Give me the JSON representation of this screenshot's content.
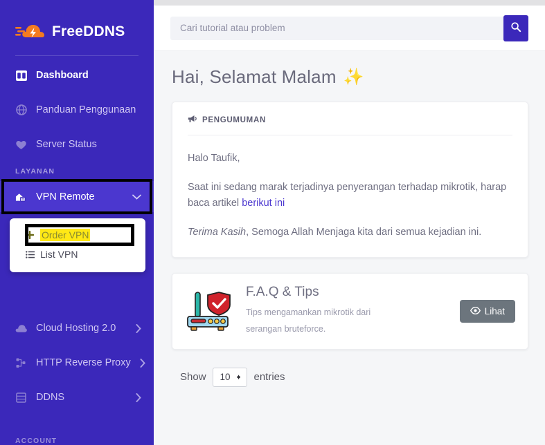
{
  "brand": {
    "name": "FreeDDNS",
    "logo_icon": "cloud-bolt-icon"
  },
  "sidebar": {
    "items_top": [
      {
        "label": "Dashboard",
        "icon": "dashboard-icon",
        "active": true
      },
      {
        "label": "Panduan Penggunaan",
        "icon": "book-globe-icon",
        "active": false
      },
      {
        "label": "Server Status",
        "icon": "heart-pulse-icon",
        "active": false
      }
    ],
    "section_layanan": "LAYANAN",
    "vpn_remote": {
      "label": "VPN Remote",
      "icon": "vpn-home-icon",
      "caret_icon": "chevron-down-icon",
      "submenu": [
        {
          "label": "Order VPN",
          "icon": "plus-icon",
          "highlighted": true
        },
        {
          "label": "List VPN",
          "icon": "list-icon",
          "highlighted": false
        }
      ]
    },
    "items_lower": [
      {
        "label": "Cloud Hosting 2.0",
        "icon": "cloud-icon",
        "caret": "chevron-right-icon"
      },
      {
        "label": "HTTP Reverse Proxy",
        "icon": "sitemap-icon",
        "caret": "chevron-right-icon"
      },
      {
        "label": "DDNS",
        "icon": "server-icon",
        "caret": "chevron-right-icon"
      }
    ],
    "section_account": "ACCOUNT"
  },
  "search": {
    "placeholder": "Cari tutorial atau problem",
    "value": "",
    "button_icon": "search-icon"
  },
  "greeting": {
    "text": "Hai, Selamat Malam",
    "emoji": "✨"
  },
  "announcement": {
    "header": "PENGUMUMAN",
    "header_icon": "megaphone-icon",
    "salutation": "Halo Taufik,",
    "body_before_link": "Saat ini sedang marak terjadinya penyerangan terhadap mikrotik, harap baca artikel ",
    "link_text": "berikut ini",
    "closing_em": "Terima Kasih",
    "closing_rest": ", Semoga Allah Menjaga kita dari semua kejadian ini."
  },
  "faq": {
    "title": "F.A.Q & Tips",
    "subtitle_line1": "Tips mengamankan mikrotik dari",
    "subtitle_line2": "serangan bruteforce.",
    "button_label": "Lihat",
    "button_icon": "eye-icon",
    "illustration_icon": "router-shield-icon"
  },
  "table_controls": {
    "show_label": "Show",
    "entries_value": "10",
    "entries_label": "entries",
    "stepper_icon": "spinner-arrows-icon"
  },
  "colors": {
    "sidebar_bg": "#3b28ba",
    "sidebar_active_bg": "#4b37cf",
    "accent": "#4b37cf",
    "highlight_yellow": "#ffe815",
    "annotation_box": "#000000",
    "content_bg": "#f5f6f8",
    "button_gray": "#6c757d"
  }
}
